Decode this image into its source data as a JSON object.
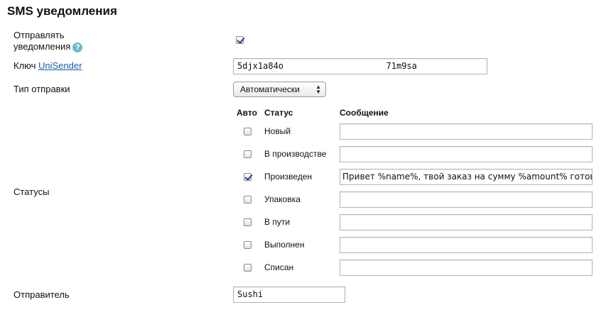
{
  "title": "SMS уведомления",
  "send_notifications": {
    "label_line1": "Отправлять",
    "label_line2": "уведомления",
    "help": "?",
    "checked": true
  },
  "key": {
    "label_prefix": "Ключ",
    "link": "UniSender",
    "value": "5djx1a84o                    71m9sa"
  },
  "send_type": {
    "label": "Тип отправки",
    "selected": "Автоматически"
  },
  "statuses": {
    "label": "Статусы",
    "headers": {
      "auto": "Авто",
      "status": "Статус",
      "message": "Сообщение"
    },
    "rows": [
      {
        "name": "Новый",
        "auto": false,
        "message": ""
      },
      {
        "name": "В производстве",
        "auto": false,
        "message": ""
      },
      {
        "name": "Произведен",
        "auto": true,
        "message": "Привет %name%, твой заказ на сумму %amount% готов"
      },
      {
        "name": "Упаковка",
        "auto": false,
        "message": ""
      },
      {
        "name": "В пути",
        "auto": false,
        "message": ""
      },
      {
        "name": "Выполнен",
        "auto": false,
        "message": ""
      },
      {
        "name": "Списан",
        "auto": false,
        "message": ""
      }
    ]
  },
  "sender": {
    "label": "Отправитель",
    "value": "Sushi"
  }
}
